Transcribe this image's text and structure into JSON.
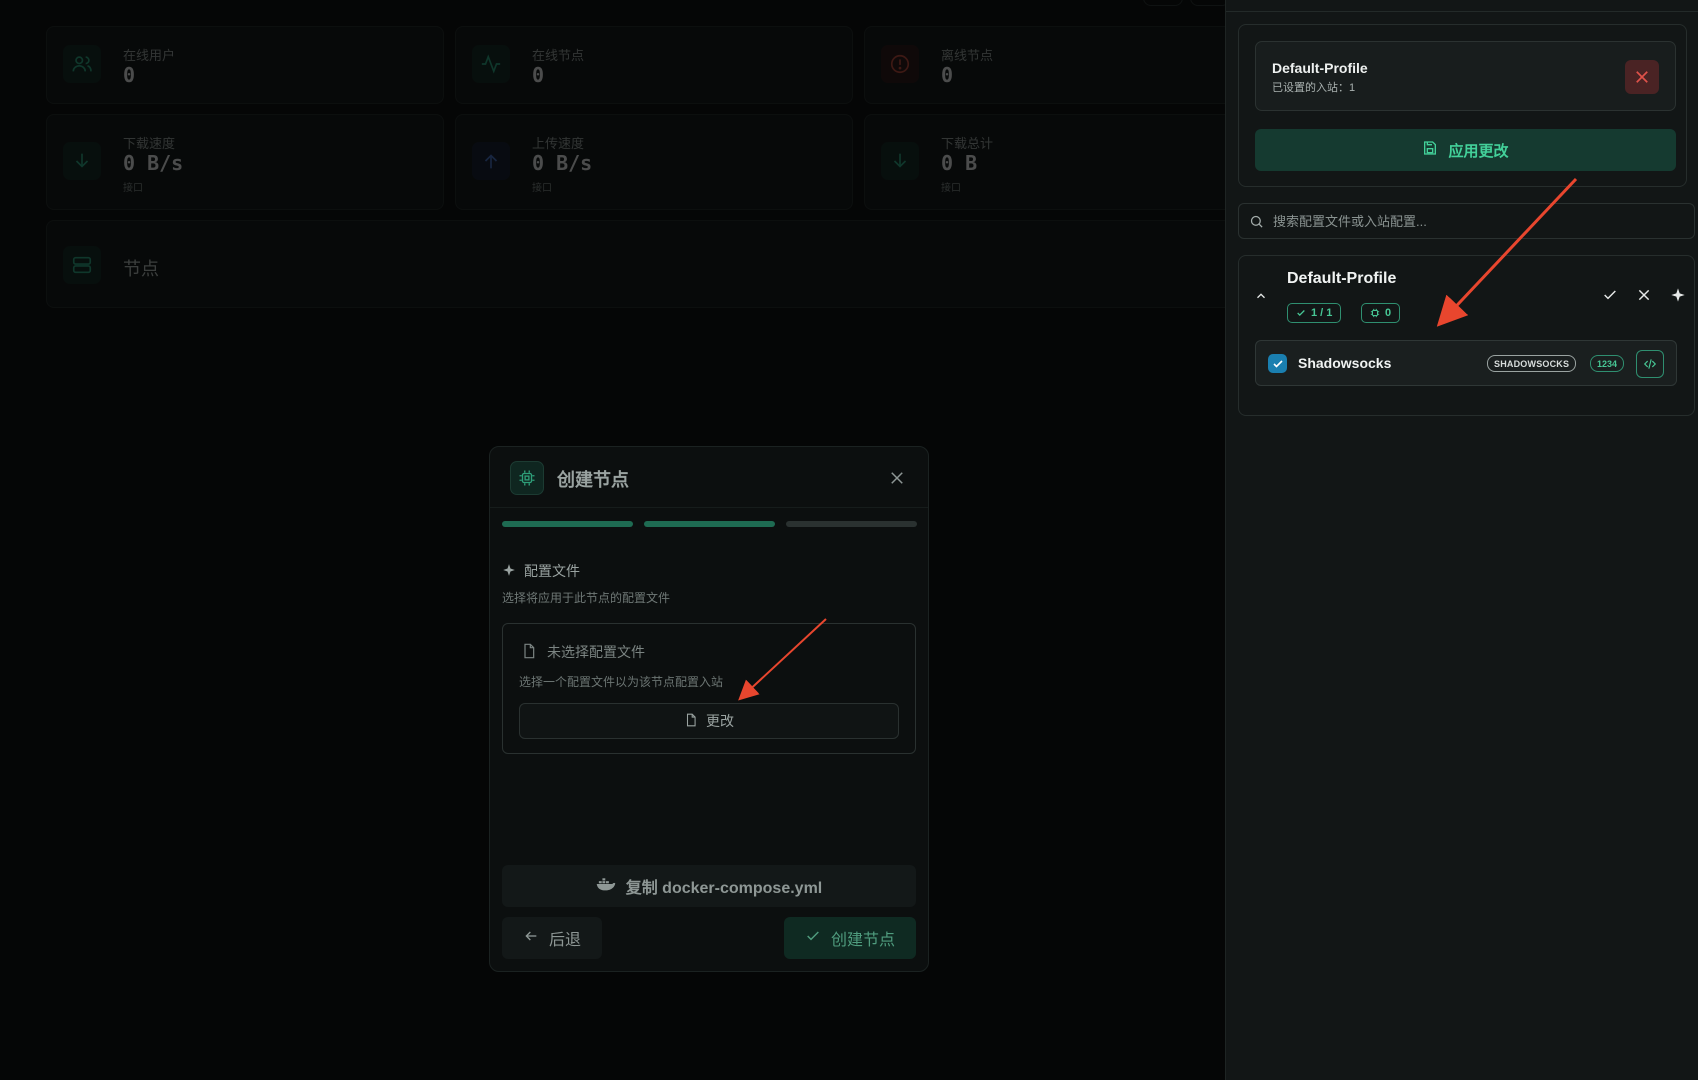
{
  "stats": [
    {
      "label": "在线用户",
      "value": "0",
      "sub": "",
      "color": "#2bb58c",
      "icon": "users-icon"
    },
    {
      "label": "在线节点",
      "value": "0",
      "sub": "",
      "color": "#2bb58c",
      "icon": "activity-icon"
    },
    {
      "label": "离线节点",
      "value": "0",
      "sub": "",
      "color": "#d14b3a",
      "icon": "alert-circle-icon"
    },
    {
      "label": "下载速度",
      "value": "0 B/s",
      "sub": "接口",
      "color": "#2bb58c",
      "icon": "download-arrow-icon"
    },
    {
      "label": "上传速度",
      "value": "0 B/s",
      "sub": "接口",
      "color": "#4a78d8",
      "icon": "upload-arrow-icon"
    },
    {
      "label": "下载总计",
      "value": "0 B",
      "sub": "接口",
      "color": "#2bb58c",
      "icon": "download-arrow-icon"
    }
  ],
  "nodes_section": {
    "title": "节点"
  },
  "modal": {
    "title": "创建节点",
    "section_title": "配置文件",
    "section_desc": "选择将应用于此节点的配置文件",
    "file_empty": "未选择配置文件",
    "file_desc": "选择一个配置文件以为该节点配置入站",
    "change_label": "更改",
    "docker_label": "复制 docker-compose.yml",
    "back_label": "后退",
    "create_label": "创建节点"
  },
  "drawer": {
    "profile_name": "Default-Profile",
    "profile_sub": "已设置的入站：1",
    "apply_label": "应用更改",
    "search_placeholder": "搜索配置文件或入站配置...",
    "group": {
      "title": "Default-Profile",
      "badge_count": "1 / 1",
      "badge_zero": "0",
      "inbound": {
        "name": "Shadowsocks",
        "protocol": "SHADOWSOCKS",
        "port": "1234"
      }
    }
  },
  "colors": {
    "accent": "#43d19a",
    "danger": "#e0524a",
    "arrow": "#e8462e"
  }
}
